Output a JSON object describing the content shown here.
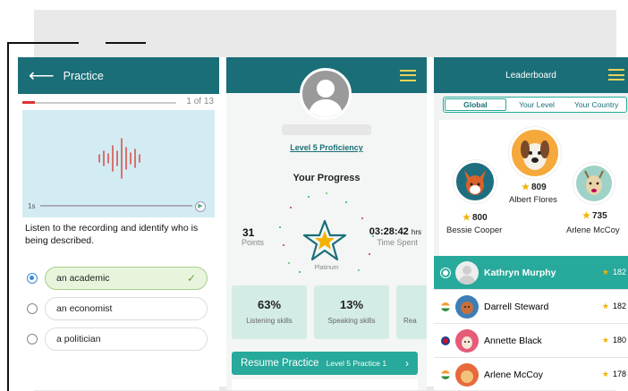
{
  "practice": {
    "title": "Practice",
    "progress_text": "1 of 13",
    "progress_fraction": 0.077,
    "audio_time": "1s",
    "question": "Listen to the recording and identify who is being described.",
    "options": [
      {
        "label": "an academic",
        "selected": true
      },
      {
        "label": "an economist",
        "selected": false
      },
      {
        "label": "a politician",
        "selected": false
      }
    ]
  },
  "progress": {
    "proficiency_link": "Level 5 Proficiency",
    "heading": "Your Progress",
    "points_value": "31",
    "points_label": "Points",
    "time_value": "03:28:42",
    "time_unit": "hrs",
    "time_label": "Time Spent",
    "badge_label": "Platinum",
    "skills": [
      {
        "pct": "63%",
        "label": "Listening skills"
      },
      {
        "pct": "13%",
        "label": "Speaking skills"
      },
      {
        "pct": "",
        "label": "Rea"
      }
    ],
    "resume_label": "Resume Practice",
    "resume_detail": "Level 5 Practice 1"
  },
  "leaderboard": {
    "title": "Leaderboard",
    "tabs": [
      "Global",
      "Your Level",
      "Your Country"
    ],
    "active_tab": "Global",
    "podium": [
      {
        "rank": 1,
        "name": "Albert Flores",
        "score": "809"
      },
      {
        "rank": 2,
        "name": "Bessie Cooper",
        "score": "800"
      },
      {
        "rank": 3,
        "name": "Arlene McCoy",
        "score": "735"
      }
    ],
    "rows": [
      {
        "name": "Kathryn Murphy",
        "score": "182",
        "highlight": true
      },
      {
        "name": "Darrell Steward",
        "score": "182",
        "highlight": false
      },
      {
        "name": "Annette Black",
        "score": "180",
        "highlight": false
      },
      {
        "name": "Arlene McCoy",
        "score": "178",
        "highlight": false
      }
    ]
  },
  "colors": {
    "teal_dark": "#1a6e77",
    "teal": "#27a99b",
    "star": "#f0b400",
    "menu": "#e7d35a"
  }
}
